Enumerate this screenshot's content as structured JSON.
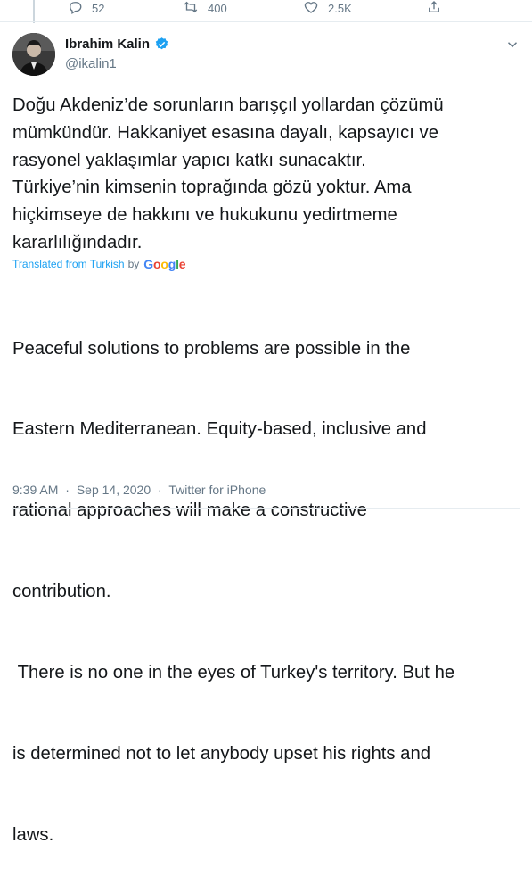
{
  "actions": {
    "reply_count": "52",
    "retweet_count": "400",
    "like_count": "2.5K"
  },
  "author": {
    "display_name": "Ibrahim Kalin",
    "handle": "@ikalin1",
    "verified_icon": "verified-badge-icon"
  },
  "tweet": {
    "line1": "Doğu Akdeniz’de sorunların barışçıl yollardan çözümü",
    "line2": "mümkündür. Hakkaniyet esasına dayalı, kapsayıcı ve",
    "line3": "rasyonel yaklaşımlar yapıcı katkı sunacaktır.",
    "line4": "Türkiye’nin kimsenin toprağında gözü yoktur. Ama",
    "line5": "hiçkimseye de hakkını ve hukukunu yedirtmeme",
    "line6": "kararlılığındadır."
  },
  "translation": {
    "label": "Translated from Turkish",
    "by": "by",
    "provider": "Google",
    "line1": "Peaceful solutions to problems are possible in the",
    "line2": "Eastern Mediterranean. Equity-based, inclusive and",
    "line3": "rational approaches will make a constructive",
    "line4": "contribution.",
    "line5": " There is no one in the eyes of Turkey's territory. But he",
    "line6": "is determined not to let anybody upset his rights and",
    "line7": "laws."
  },
  "meta": {
    "time": "9:39 AM",
    "date": "Sep 14, 2020",
    "separator": "·",
    "source": "Twitter for iPhone"
  },
  "colors": {
    "accent": "#1da1f2",
    "muted": "#657786"
  }
}
